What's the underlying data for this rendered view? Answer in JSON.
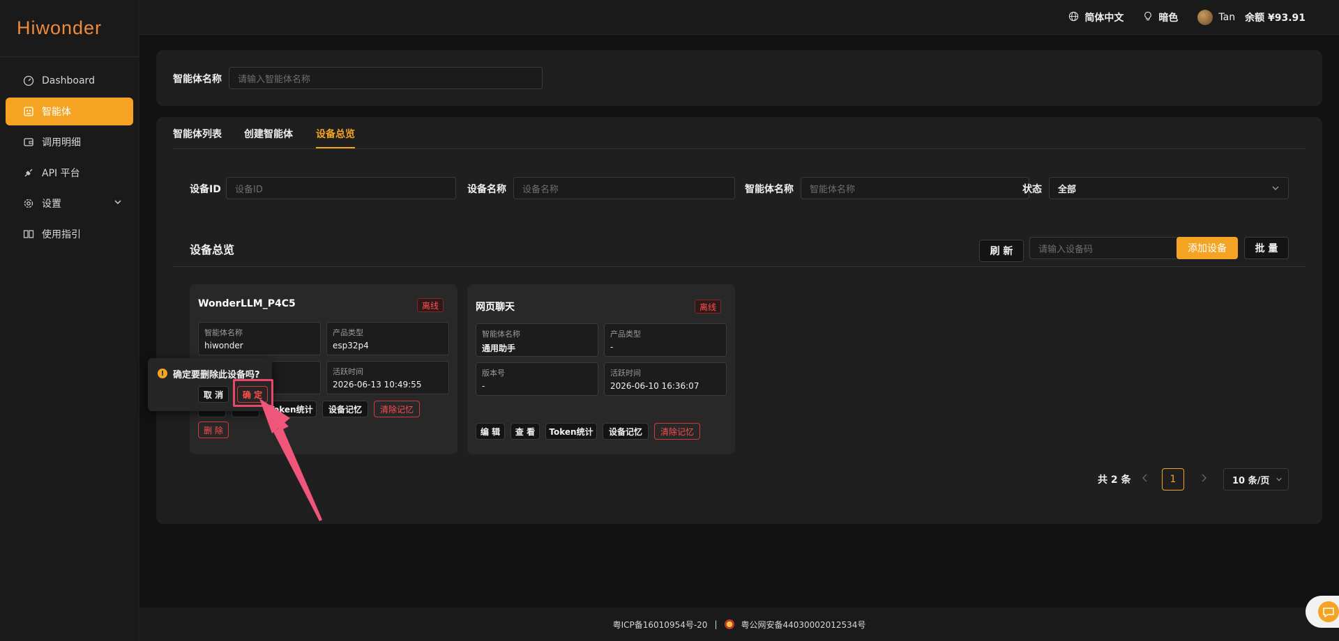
{
  "brand": "Hiwonder",
  "sidebar": {
    "items": [
      {
        "label": "Dashboard",
        "icon": "dashboard-icon"
      },
      {
        "label": "智能体",
        "icon": "robot-icon"
      },
      {
        "label": "调用明细",
        "icon": "wallet-icon"
      },
      {
        "label": "API 平台",
        "icon": "plug-icon"
      },
      {
        "label": "设置",
        "icon": "gear-icon"
      },
      {
        "label": "使用指引",
        "icon": "book-icon"
      }
    ]
  },
  "header": {
    "language": "简体中文",
    "theme": "暗色",
    "username": "Tan",
    "balance": "余额 ¥93.91"
  },
  "filter_top": {
    "label": "智能体名称",
    "placeholder": "请输入智能体名称"
  },
  "tabs": [
    {
      "label": "智能体列表"
    },
    {
      "label": "创建智能体"
    },
    {
      "label": "设备总览",
      "active": true
    }
  ],
  "device_filters": {
    "device_id_label": "设备ID",
    "device_id_placeholder": "设备ID",
    "device_name_label": "设备名称",
    "device_name_placeholder": "设备名称",
    "agent_name_label": "智能体名称",
    "agent_name_placeholder": "智能体名称",
    "status_label": "状态",
    "status_value": "全部"
  },
  "section": {
    "title": "设备总览",
    "refresh": "刷 新",
    "code_placeholder": "请输入设备码",
    "add_device": "添加设备",
    "batch": "批 量"
  },
  "devices": [
    {
      "name": "WonderLLM_P4C5",
      "status": "离线",
      "agent_name_key": "智能体名称",
      "agent_name": "hiwonder",
      "product_type_key": "产品类型",
      "product_type": "esp32p4",
      "active_time_key": "活跃时间",
      "active_time": "2026-06-13 10:49:55",
      "token_btn": "Token统计",
      "memory_btn": "设备记忆",
      "clear_btn": "清除记忆",
      "delete_btn": "删 除"
    },
    {
      "name": "网页聊天",
      "status": "离线",
      "agent_name_key": "智能体名称",
      "agent_name": "通用助手",
      "product_type_key": "产品类型",
      "product_type": "-",
      "version_key": "版本号",
      "version": "-",
      "active_time_key": "活跃时间",
      "active_time": "2026-06-10 16:36:07",
      "edit_btn": "编 辑",
      "view_btn": "查 看",
      "token_btn": "Token统计",
      "memory_btn": "设备记忆",
      "clear_btn": "清除记忆"
    }
  ],
  "popconfirm": {
    "message": "确定要删除此设备吗?",
    "cancel": "取 消",
    "confirm": "确 定"
  },
  "pagination": {
    "total": "共 2 条",
    "current_page": "1",
    "page_size": "10 条/页"
  },
  "footer": {
    "icp": "粤ICP备16010954号-20",
    "separator": "|",
    "police": "粤公网安备44030002012534号"
  },
  "colors": {
    "accent": "#f5a323",
    "danger": "#ff4d4f",
    "background": "#121212",
    "panel": "#1f1f1f",
    "annotation": "#e8476a"
  }
}
